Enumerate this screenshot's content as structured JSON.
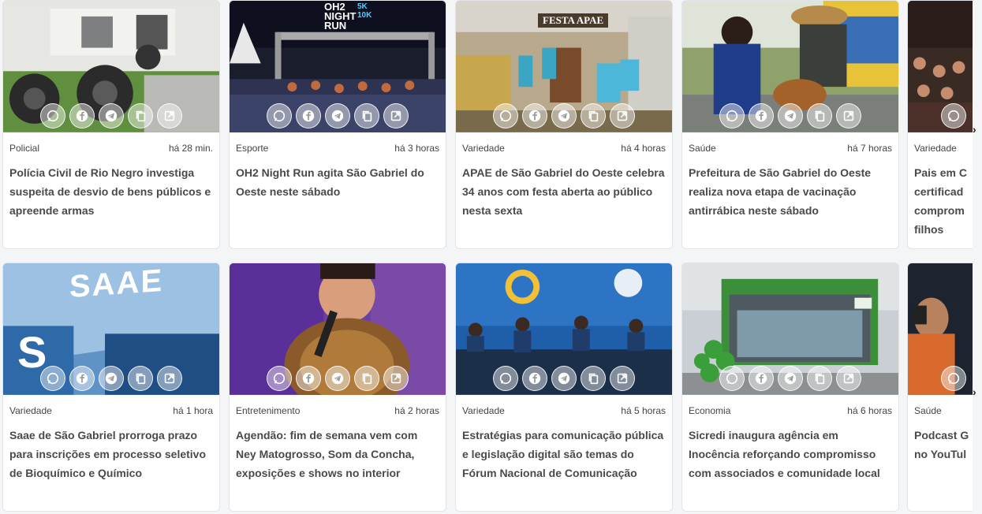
{
  "icons": {
    "share": [
      "whatsapp-icon",
      "facebook-icon",
      "telegram-icon",
      "copy-icon",
      "open-external-icon"
    ]
  },
  "colors": {
    "title": "#4a4a4a",
    "meta": "#444444",
    "card_border": "#e2e4e8",
    "background": "#f4f5f7"
  },
  "rows": [
    {
      "cards": [
        {
          "category": "Policial",
          "time": "há 28 min.",
          "title": "Polícia Civil de Rio Negro investiga suspeita de desvio de bens públicos e apreende armas"
        },
        {
          "category": "Esporte",
          "time": "há 3 horas",
          "title": "OH2 Night Run agita São Gabriel do Oeste neste sábado",
          "image_text": {
            "main": "OH2 NIGHT RUN",
            "sub": "5K 10K"
          }
        },
        {
          "category": "Variedade",
          "time": "há 4 horas",
          "title": "APAE de São Gabriel do Oeste celebra 34 anos com festa aberta ao público nesta sexta",
          "image_text": {
            "main": "FESTA APAE"
          }
        },
        {
          "category": "Saúde",
          "time": "há 7 horas",
          "title": "Prefeitura de São Gabriel do Oeste realiza nova etapa de vacinação antirrábica neste sábado"
        },
        {
          "category": "Variedade",
          "time": "",
          "title": "Pais em C certificad comprom filhos"
        }
      ]
    },
    {
      "cards": [
        {
          "category": "Variedade",
          "time": "há 1 hora",
          "title": "Saae de São Gabriel prorroga prazo para inscrições em processo seletivo de Bioquímico e Químico",
          "image_text": {
            "main": "SAAE",
            "sub": "S"
          }
        },
        {
          "category": "Entretenimento",
          "time": "há 2 horas",
          "title": "Agendão: fim de semana vem com Ney Matogrosso, Som da Concha, exposições e shows no interior"
        },
        {
          "category": "Variedade",
          "time": "há 5 horas",
          "title": "Estratégias para comunicação pública e legislação digital são temas do Fórum Nacional de Comunicação"
        },
        {
          "category": "Economia",
          "time": "há 6 horas",
          "title": "Sicredi inaugura agência em Inocência reforçando compromisso com associados e comunidade local"
        },
        {
          "category": "Saúde",
          "time": "",
          "title": "Podcast G no YouTul"
        }
      ]
    }
  ],
  "arrows": {
    "next": "›"
  }
}
